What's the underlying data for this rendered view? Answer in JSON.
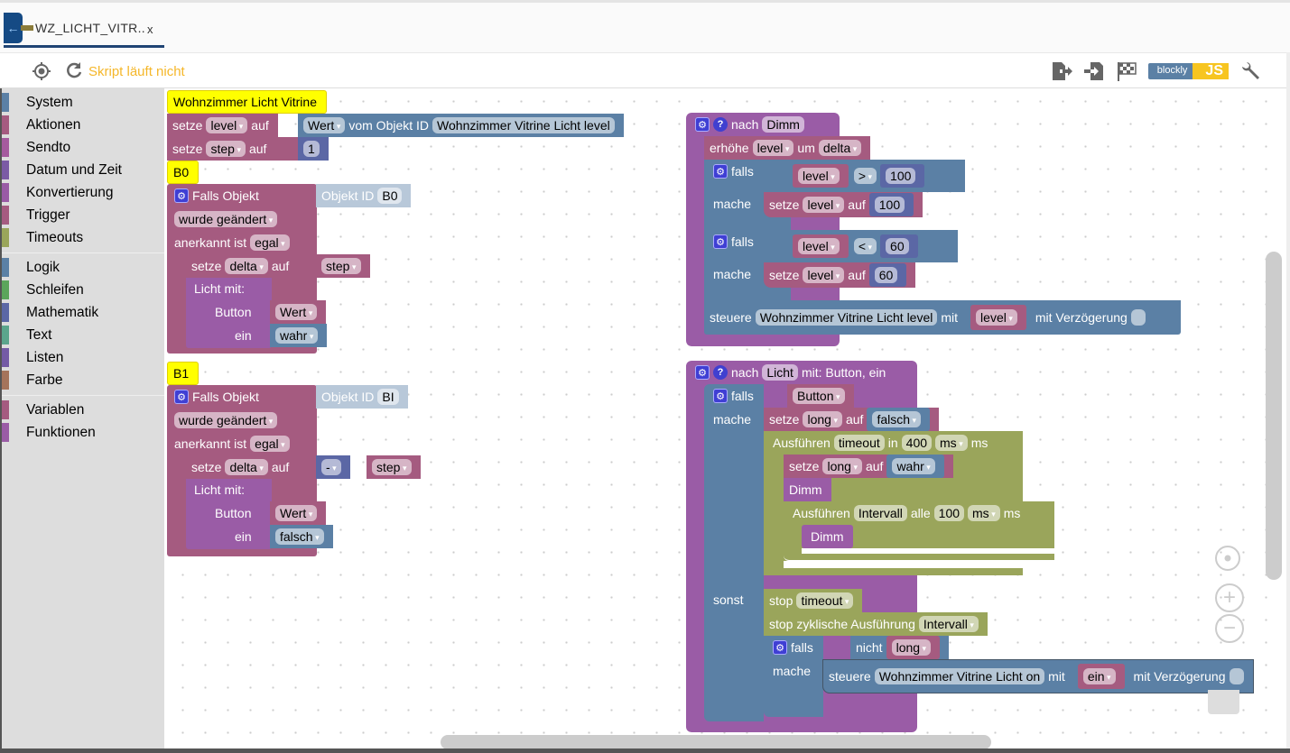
{
  "tab": {
    "title": "WZ_LICHT_VITR..",
    "close": "x",
    "back_icon": "arrow-left-icon"
  },
  "toolbar": {
    "status": "Skript läuft nicht",
    "left_icons": [
      "locate-icon",
      "restart-icon"
    ],
    "right_icons": [
      "export-icon",
      "import-icon",
      "flag-icon",
      "blockly-js-toggle",
      "wrench-icon"
    ],
    "blockly_label": "blockly",
    "js_label": "JS"
  },
  "colors": {
    "accent": "#1f4474",
    "status": "#f5b72a",
    "variables": "#a55b80",
    "system": "#5b80a5",
    "functions": "#9a5ca6",
    "timeouts": "#9aa55b",
    "math": "#5b67a5",
    "comment": "#ffff00"
  },
  "sidebar": {
    "groups": [
      [
        {
          "label": "System",
          "color": "#5b80a5"
        },
        {
          "label": "Aktionen",
          "color": "#a55b80"
        },
        {
          "label": "Sendto",
          "color": "#a55b9e"
        },
        {
          "label": "Datum und Zeit",
          "color": "#7b5ba5"
        },
        {
          "label": "Konvertierung",
          "color": "#995ba5"
        },
        {
          "label": "Trigger",
          "color": "#a55b80"
        },
        {
          "label": "Timeouts",
          "color": "#9aa55b"
        }
      ],
      [
        {
          "label": "Logik",
          "color": "#5b80a5"
        },
        {
          "label": "Schleifen",
          "color": "#5ba55b"
        },
        {
          "label": "Mathematik",
          "color": "#5b67a5"
        },
        {
          "label": "Text",
          "color": "#5ba58c"
        },
        {
          "label": "Listen",
          "color": "#745ba5"
        },
        {
          "label": "Farbe",
          "color": "#a5745b"
        }
      ],
      [
        {
          "label": "Variablen",
          "color": "#a55b80"
        },
        {
          "label": "Funktionen",
          "color": "#9a5ca6"
        }
      ]
    ]
  },
  "blocks": {
    "c1": "Wohnzimmer Licht Vitrine",
    "set": "setze",
    "auf": "auf",
    "level": "level",
    "step": "step",
    "wert": "Wert",
    "vom": "vom Objekt ID",
    "obj_level": "Wohnzimmer Vitrine Licht level",
    "one": "1",
    "b0": "B0",
    "b1": "B1",
    "falls_obj": "Falls Objekt",
    "objid": "Objekt ID",
    "b0v": "B0",
    "b1v": "BI",
    "changed": "wurde geändert",
    "ack": "anerkannt ist",
    "egal": "egal",
    "delta": "delta",
    "minus": "-",
    "licht_mit": "Licht  mit:",
    "button": "Button",
    "ein": "ein",
    "wahr": "wahr",
    "falsch": "falsch",
    "nach": "nach",
    "dimm": "Dimm",
    "erhoehe": "erhöhe",
    "um": "um",
    "falls": "falls",
    "mache": "mache",
    "gt": ">",
    "lt": "<",
    "v100": "100",
    "v60": "60",
    "steuere": "steuere",
    "mit": "mit",
    "delay": "mit Verzögerung",
    "licht": "Licht",
    "mitparams": "mit: Button, ein",
    "long": "long",
    "ausf": "Ausführen",
    "timeout": "timeout",
    "in": "in",
    "v400": "400",
    "ms": "ms",
    "intervall": "Intervall",
    "alle": "alle",
    "sonst": "sonst",
    "stop": "stop",
    "stopz": "stop zyklische Ausführung",
    "nicht": "nicht",
    "obj_on": "Wohnzimmer Vitrine Licht on"
  }
}
